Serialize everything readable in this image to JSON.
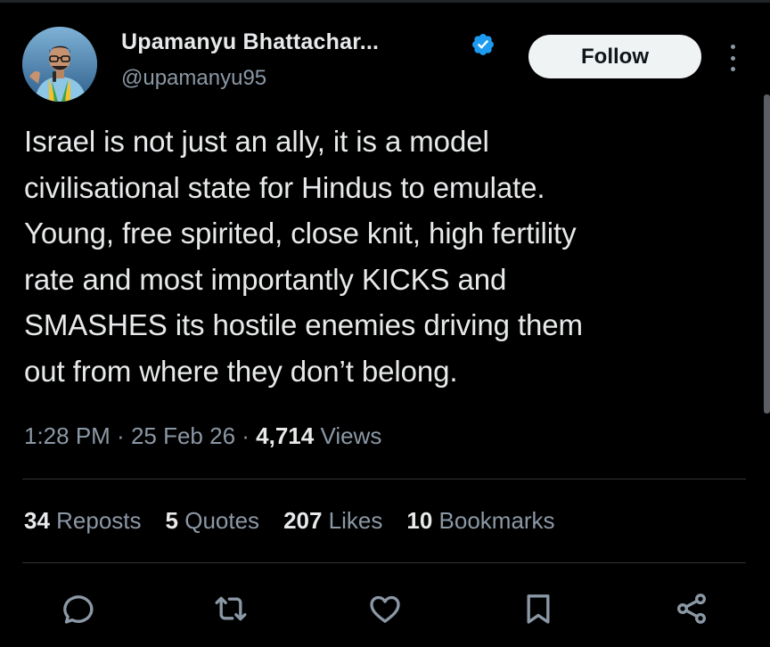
{
  "author": {
    "display_name": "Upamanyu Bhattachar...",
    "handle": "@upamanyu95",
    "verified": true,
    "avatar_icon": "profile-photo"
  },
  "follow_button": {
    "label": "Follow"
  },
  "more_icon": "more-vertical-icon",
  "tweet": {
    "text": "Israel is not just an ally, it is a model\ncivilisational state for Hindus to emulate.\nYoung, free spirited, close knit, high fertility\nrate and most importantly KICKS and\nSMASHES its hostile enemies driving them\nout from where they don’t belong."
  },
  "meta": {
    "time": "1:28 PM",
    "sep1": " · ",
    "date": "25 Feb 26",
    "sep2": " · ",
    "views_count": "4,714",
    "views_label": " Views"
  },
  "stats": {
    "reposts_count": "34",
    "reposts_label": " Reposts",
    "quotes_count": "5",
    "quotes_label": " Quotes",
    "likes_count": "207",
    "likes_label": " Likes",
    "bookmarks_count": "10",
    "bookmarks_label": " Bookmarks"
  },
  "actions": [
    "reply-icon",
    "repost-icon",
    "like-icon",
    "bookmark-icon",
    "share-icon"
  ],
  "colors": {
    "background": "#000000",
    "primary_text": "#e7e9ea",
    "secondary_text": "#8b98a5",
    "verified_blue": "#1d9bf0",
    "divider": "#2f3336",
    "follow_bg": "#eff3f4"
  }
}
